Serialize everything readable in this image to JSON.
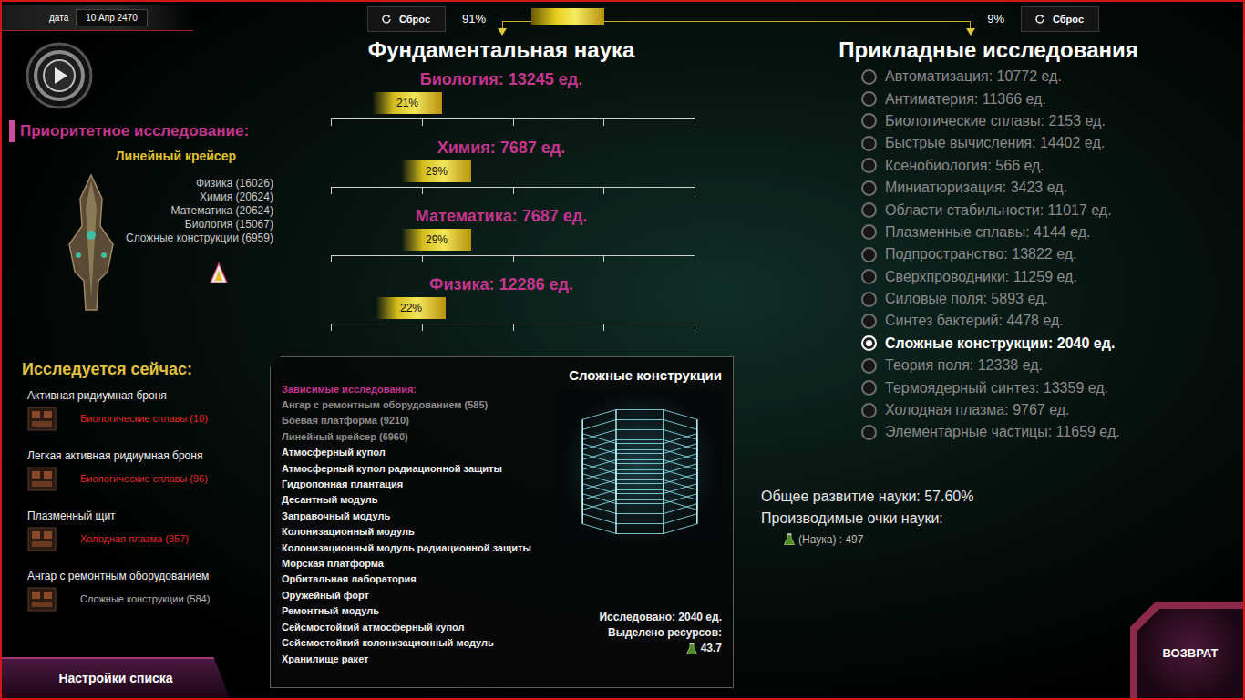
{
  "header": {
    "date_label": "дата",
    "date": "10 Апр 2470"
  },
  "priority": {
    "title": "Приоритетное исследование:",
    "name": "Линейный крейсер",
    "requirements": [
      "Физика (16026)",
      "Химия (20624)",
      "Математика (20624)",
      "Биология (15067)",
      "Сложные конструкции (6959)"
    ]
  },
  "current": {
    "title": "Исследуется сейчас:",
    "items": [
      {
        "name": "Активная ридиумная броня",
        "requirement": "Биологические сплавы (10)",
        "color": "#e02828"
      },
      {
        "name": "Легкая активная ридиумная броня",
        "requirement": "Биологические сплавы (96)",
        "color": "#e02828"
      },
      {
        "name": "Плазменный щит",
        "requirement": "Холодная плазма (357)",
        "color": "#e02828"
      },
      {
        "name": "Ангар с ремонтным оборудованием",
        "requirement": "Сложные конструкции (584)",
        "color": "#b4b4b4"
      }
    ]
  },
  "list_settings_button": "Настройки списка",
  "balance": {
    "reset_left": "Сброс",
    "left_reading": "91%",
    "level": 0.14,
    "right_reading": "9%",
    "reset_right": "Сброс"
  },
  "fundamental": {
    "title": "Фундаментальная наука",
    "sciences": [
      {
        "name": "Биология: 13245 ед.",
        "reading": "21%",
        "level": 0.21
      },
      {
        "name": "Химия: 7687 ед.",
        "reading": "29%",
        "level": 0.29
      },
      {
        "name": "Математика: 7687 ед.",
        "reading": "29%",
        "level": 0.29
      },
      {
        "name": "Физика: 12286 ед.",
        "reading": "22%",
        "level": 0.22
      }
    ]
  },
  "applied": {
    "title": "Прикладные исследования",
    "items": [
      {
        "label": "Автоматизация: 10772 ед.",
        "selected": false
      },
      {
        "label": "Антиматерия: 11366 ед.",
        "selected": false
      },
      {
        "label": "Биологические сплавы: 2153 ед.",
        "selected": false
      },
      {
        "label": "Быстрые вычисления: 14402 ед.",
        "selected": false
      },
      {
        "label": "Ксенобиология: 566 ед.",
        "selected": false
      },
      {
        "label": "Миниатюризация: 3423 ед.",
        "selected": false
      },
      {
        "label": "Области стабильности: 11017 ед.",
        "selected": false
      },
      {
        "label": "Плазменные сплавы: 4144 ед.",
        "selected": false
      },
      {
        "label": "Подпространство: 13822 ед.",
        "selected": false
      },
      {
        "label": "Сверхпроводники: 11259 ед.",
        "selected": false
      },
      {
        "label": "Силовые поля: 5893 ед.",
        "selected": false
      },
      {
        "label": "Синтез бактерий: 4478 ед.",
        "selected": false
      },
      {
        "label": "Сложные конструкции: 2040 ед.",
        "selected": true
      },
      {
        "label": "Теория поля: 12338 ед.",
        "selected": false
      },
      {
        "label": "Термоядерный синтез: 13359 ед.",
        "selected": false
      },
      {
        "label": "Холодная плазма: 9767 ед.",
        "selected": false
      },
      {
        "label": "Элементарные частицы: 11659 ед.",
        "selected": false
      }
    ]
  },
  "detail": {
    "title": "Сложные конструкции",
    "dependents_title": "Зависимые исследования:",
    "dependents": [
      {
        "label": "Ангар с ремонтным оборудованием (585)",
        "dimmed": true
      },
      {
        "label": "Боевая платформа (9210)",
        "dimmed": true
      },
      {
        "label": "Линейный крейсер (6960)",
        "dimmed": true
      },
      {
        "label": "Атмосферный купол",
        "dimmed": false
      },
      {
        "label": "Атмосферный купол радиационной защиты",
        "dimmed": false
      },
      {
        "label": "Гидропонная плантация",
        "dimmed": false
      },
      {
        "label": "Десантный модуль",
        "dimmed": false
      },
      {
        "label": "Заправочный модуль",
        "dimmed": false
      },
      {
        "label": "Колонизационный модуль",
        "dimmed": false
      },
      {
        "label": "Колонизационный модуль радиационной защиты",
        "dimmed": false
      },
      {
        "label": "Морская платформа",
        "dimmed": false
      },
      {
        "label": "Орбитальная лаборатория",
        "dimmed": false
      },
      {
        "label": "Оружейный форт",
        "dimmed": false
      },
      {
        "label": "Ремонтный модуль",
        "dimmed": false
      },
      {
        "label": "Сейсмостойкий атмосферный купол",
        "dimmed": false
      },
      {
        "label": "Сейсмостойкий колонизационный модуль",
        "dimmed": false
      },
      {
        "label": "Хранилище ракет",
        "dimmed": false
      }
    ],
    "researched": "Исследовано: 2040 ед.",
    "allocated_label": "Выделено ресурсов:",
    "allocated": "43.7"
  },
  "stats": {
    "overall": "Общее развитие науки: 57.60%",
    "points_label": "Производимые очки науки:",
    "points": "(Наука) : 497"
  },
  "return_button": "ВОЗВРАТ"
}
